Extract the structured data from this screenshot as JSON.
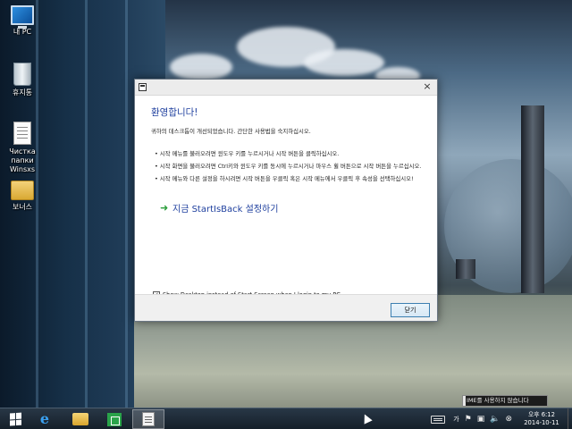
{
  "desktop": {
    "icons": [
      {
        "label": "내 PC",
        "icon": "computer-icon"
      },
      {
        "label": "휴지통",
        "icon": "recycle-bin-icon"
      },
      {
        "label": "Чистка папки Winsxs",
        "icon": "document-icon"
      },
      {
        "label": "보너스",
        "icon": "folder-icon"
      }
    ]
  },
  "dialog": {
    "title": "",
    "close_glyph": "×",
    "heading": "환영합니다!",
    "intro": "귀하의 데스크톱이 개선되었습니다. 간단한 사용법을 숙지하십시오.",
    "bullets": [
      "• 시작 메뉴를 불러오려면 윈도우 키를 누르시거나 시작 버튼을 클릭하십시오.",
      "• 시작 화면을 불러오려면 Ctrl키와 윈도우 키를 동시에 누르시거나 마우스 휠 버튼으로 시작 버튼을 누르십시오.",
      "• 시작 메뉴와 다른 설정을 하시려면 시작 버튼을 우클릭 혹은 시작 메뉴에서 우클릭 후 속성을 선택하십시오!"
    ],
    "link_arrow": "➜",
    "link_text": "지금 StartIsBack 설정하기",
    "checkbox_label": "Show Desktop instead of Start Screen when I login to my PC",
    "checkbox_checked": true,
    "checkbox_mark": "✓",
    "close_button": "닫기"
  },
  "tooltip": {
    "text": "IME를 사용하지 않습니다"
  },
  "taskbar": {
    "buttons": [
      "start-button",
      "internet-explorer-icon",
      "file-explorer-icon",
      "store-icon",
      "startisback-app-icon"
    ],
    "tray": {
      "ime_label": "가",
      "icons": [
        "flag-icon",
        "network-icon",
        "volume-icon",
        "ime-disabled-icon"
      ],
      "glyphs": [
        "⚑",
        "▣",
        "🔈",
        "⊗"
      ],
      "time": "오후 6:12",
      "date": "2014-10-11"
    }
  }
}
